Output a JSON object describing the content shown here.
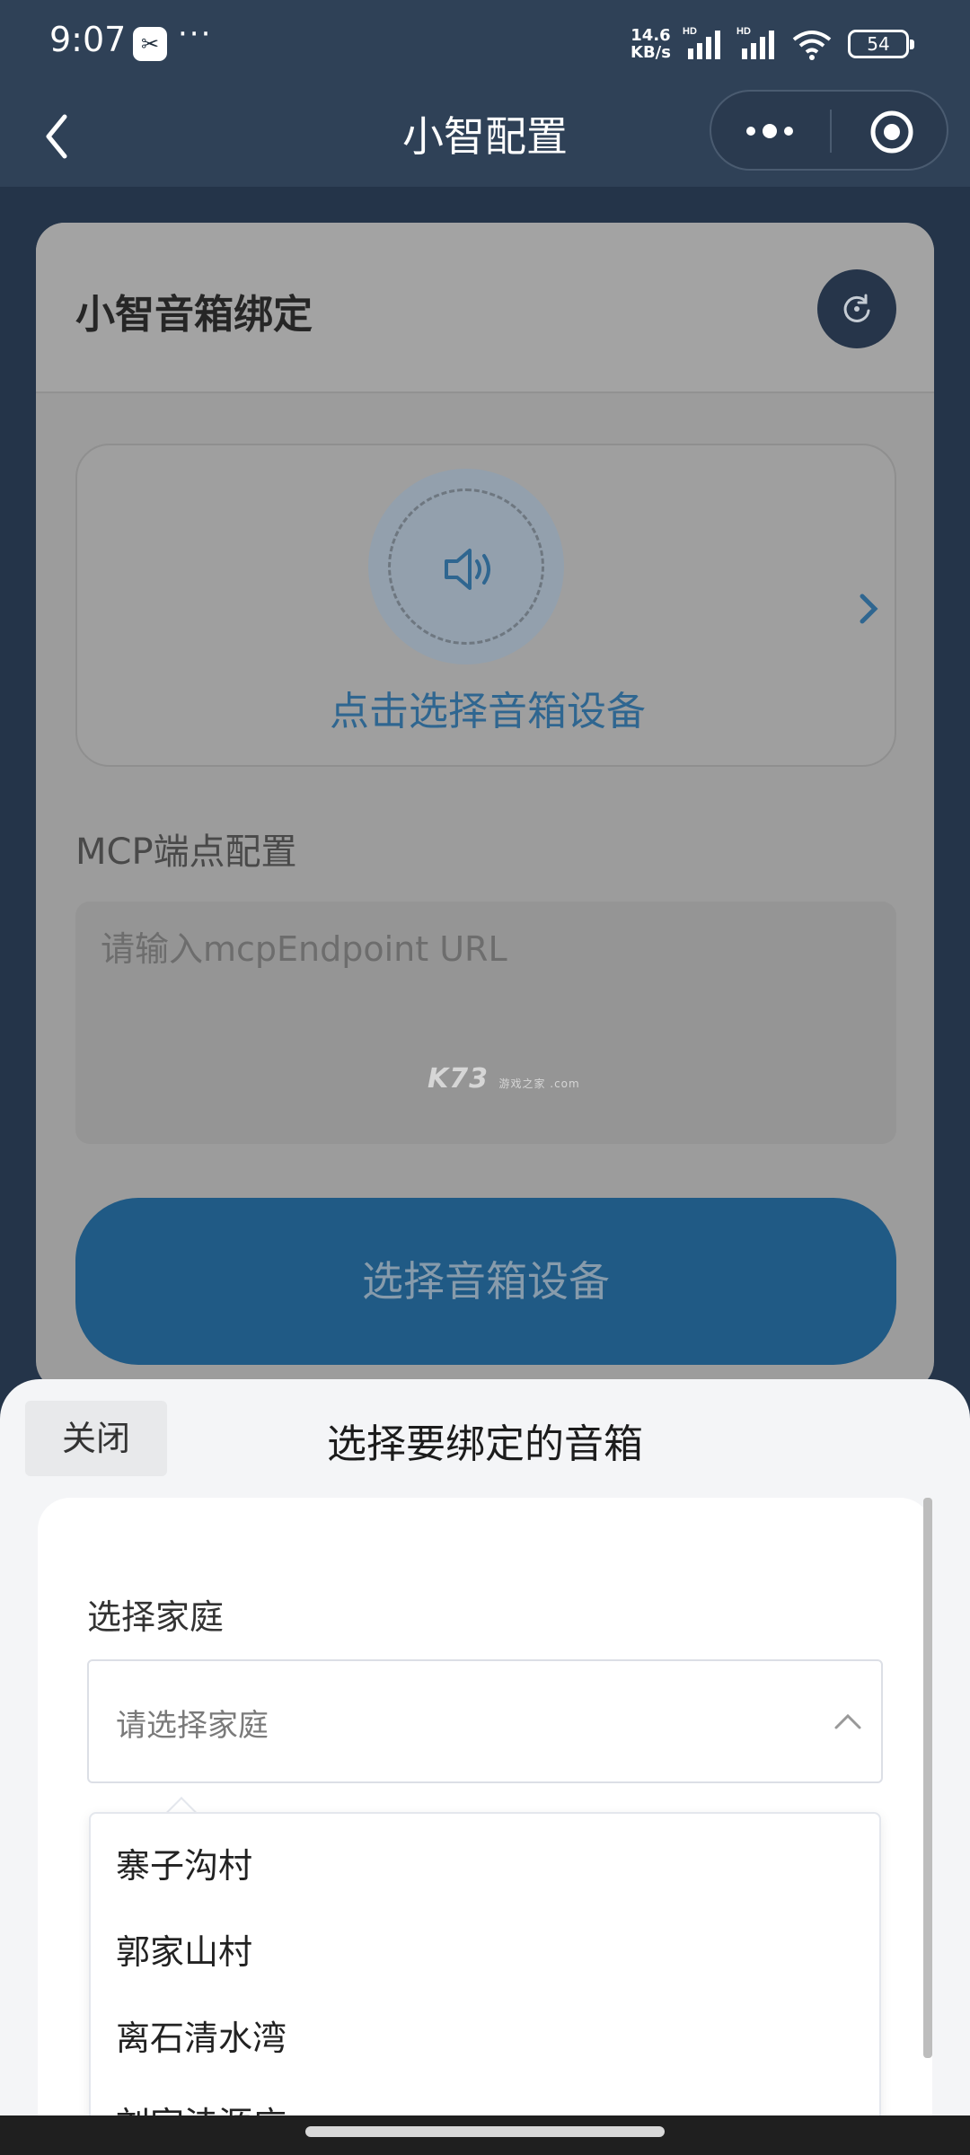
{
  "status_bar": {
    "time": "9:07",
    "app_icon_glyph": "✂",
    "overflow": "···",
    "net_speed_value": "14.6",
    "net_speed_unit": "KB/s",
    "battery": "54"
  },
  "nav": {
    "title": "小智配置"
  },
  "card": {
    "title": "小智音箱绑定",
    "device_prompt": "点击选择音箱设备",
    "mcp_label": "MCP端点配置",
    "mcp_placeholder": "请输入mcpEndpoint URL",
    "select_button": "选择音箱设备"
  },
  "watermark": {
    "main": "K73",
    "sub": "游戏之家 .com"
  },
  "sheet": {
    "close_label": "关闭",
    "title": "选择要绑定的音箱",
    "family_label": "选择家庭",
    "family_placeholder": "请选择家庭",
    "options": [
      "寨子沟村",
      "郭家山村",
      "离石清水湾",
      "刘家洼源庄"
    ]
  },
  "colors": {
    "header_bg": "#2f4157",
    "primary_button": "#205a85",
    "accent_text": "#2f6690"
  },
  "icons": [
    "back-arrow-icon",
    "more-dots-icon",
    "target-icon",
    "refresh-icon",
    "speaker-icon",
    "chevron-right-icon",
    "chevron-up-icon",
    "signal-icon",
    "wifi-icon",
    "battery-icon"
  ]
}
